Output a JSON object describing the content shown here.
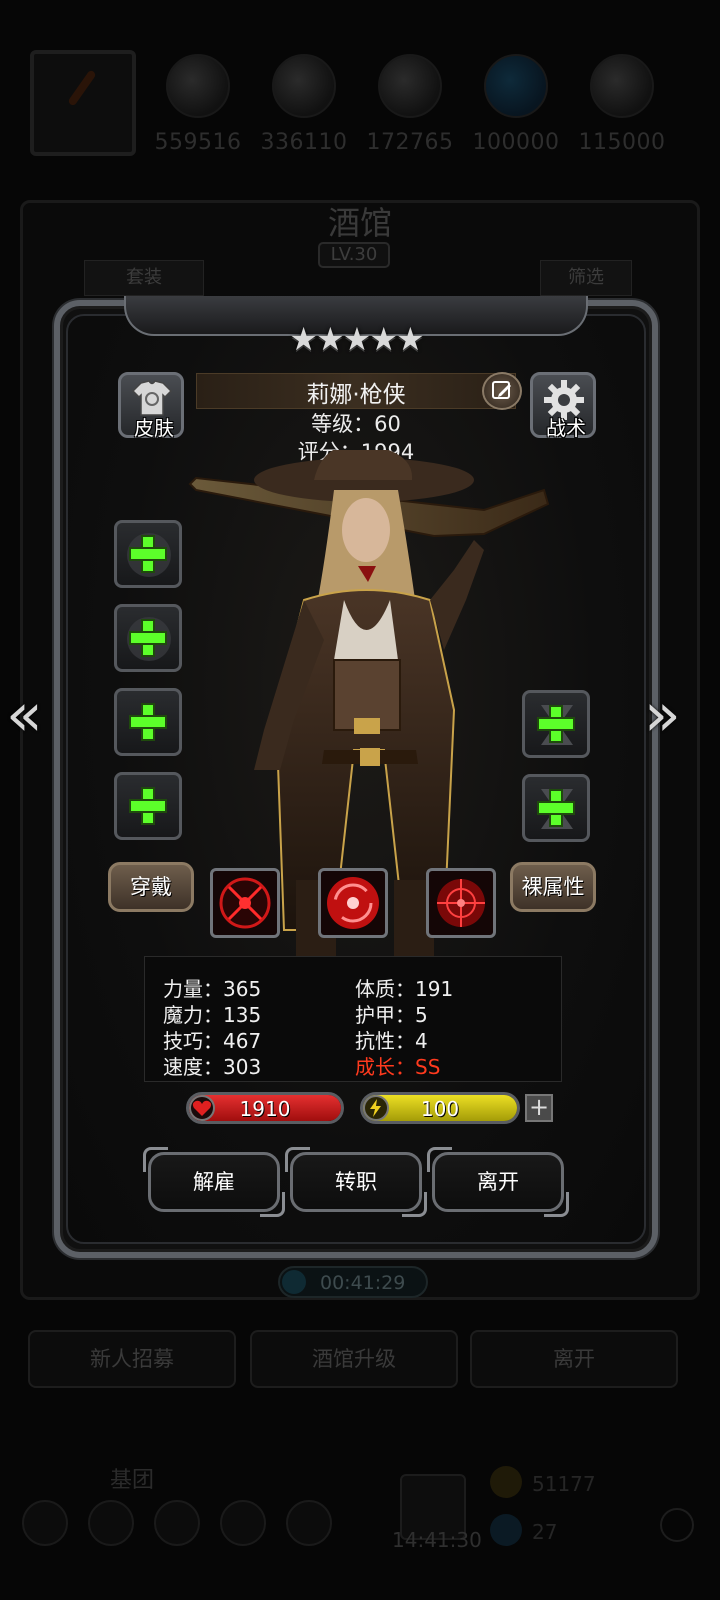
{
  "resources": [
    {
      "icon": "portrait-slot",
      "value": ""
    },
    {
      "icon": "wood-icon",
      "value": "559516"
    },
    {
      "icon": "ore-icon",
      "value": "336110"
    },
    {
      "icon": "iron-icon",
      "value": "172765"
    },
    {
      "icon": "crystal-icon",
      "value": "100000"
    },
    {
      "icon": "stone-icon",
      "value": "115000"
    }
  ],
  "tavern": {
    "title": "酒馆",
    "level": "LV.30",
    "set_label": "套装",
    "filter_label": "筛选",
    "timer": "00:41:29",
    "recruit_label": "新人招募",
    "upgrade_label": "酒馆升级",
    "leave_label": "离开"
  },
  "bottom": {
    "guild_label": "基团",
    "clock": "14:41:30",
    "coins": "51177",
    "gems": "27"
  },
  "hero": {
    "stars": "★★★★★",
    "name": "莉娜·枪侠",
    "level_line": "等级：60",
    "score_line": "评分：1994",
    "skin_label": "皮肤",
    "tactics_label": "战术",
    "equip_label": "穿戴",
    "bare_attr_label": "裸属性",
    "stats": {
      "strength": "力量：365",
      "magic": "魔力：135",
      "skill": "技巧：467",
      "speed": "速度：303",
      "constitution": "体质：191",
      "armor": "护甲：5",
      "resistance": "抗性：4",
      "growth": "成长：SS"
    },
    "hp": "1910",
    "energy": "100",
    "plus": "+",
    "actions": {
      "dismiss": "解雇",
      "transfer": "转职",
      "leave": "离开"
    }
  },
  "colors": {
    "accent_green": "#5cff2a",
    "hp_red": "#d01818",
    "energy_yellow": "#c9c20c",
    "growth_red": "#ff3a1e"
  },
  "nav": {
    "prev": "«",
    "next": "»"
  }
}
